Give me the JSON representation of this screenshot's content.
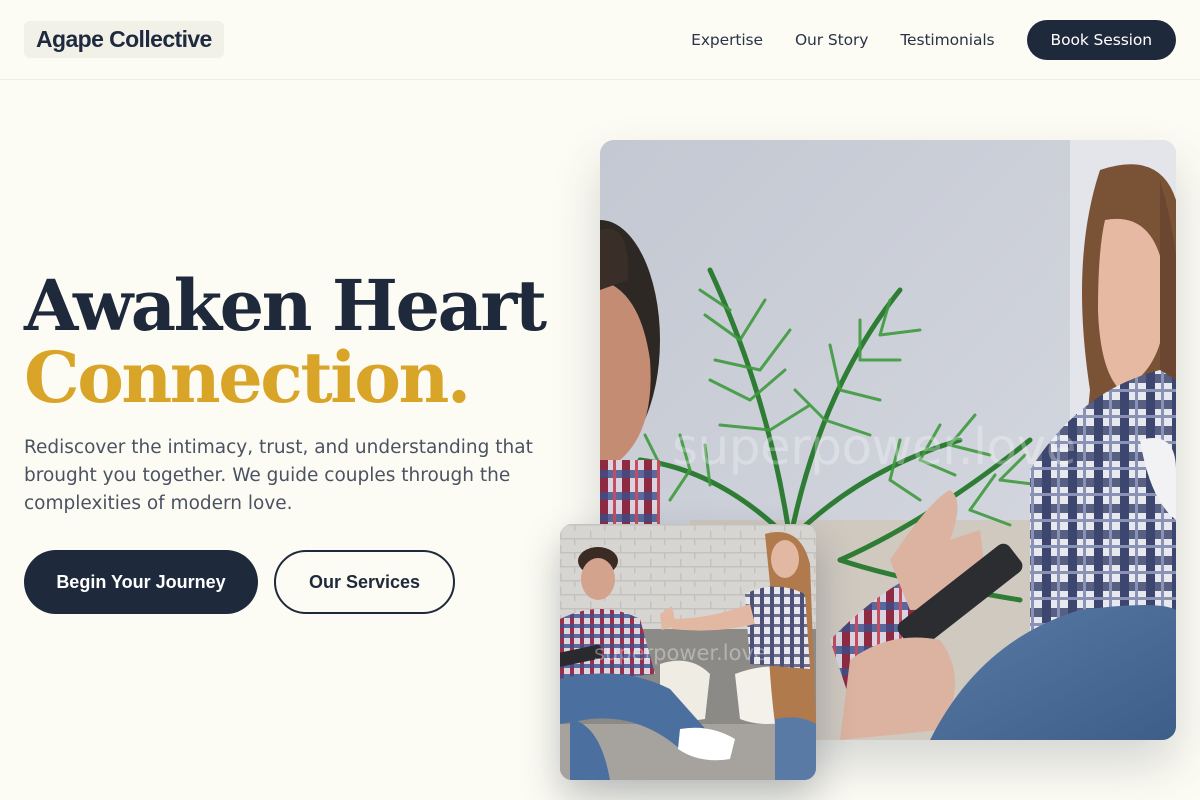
{
  "brand": {
    "name": "Agape Collective"
  },
  "nav": {
    "links": [
      "Expertise",
      "Our Story",
      "Testimonials"
    ],
    "cta": "Book Session"
  },
  "hero": {
    "title_line1": "Awaken Heart",
    "title_line2": "Connection.",
    "description": "Rediscover the intimacy, trust, and understanding that brought you together. We guide couples through the complexities of modern love.",
    "primary_button": "Begin Your Journey",
    "secondary_button": "Our Services"
  },
  "images": {
    "main_watermark": "superpower.love",
    "inset_watermark": "superpower.love"
  },
  "colors": {
    "background": "#fdfcf4",
    "navy": "#1e293b",
    "accent_gold": "#d9a528",
    "body_text": "#4b5262"
  }
}
